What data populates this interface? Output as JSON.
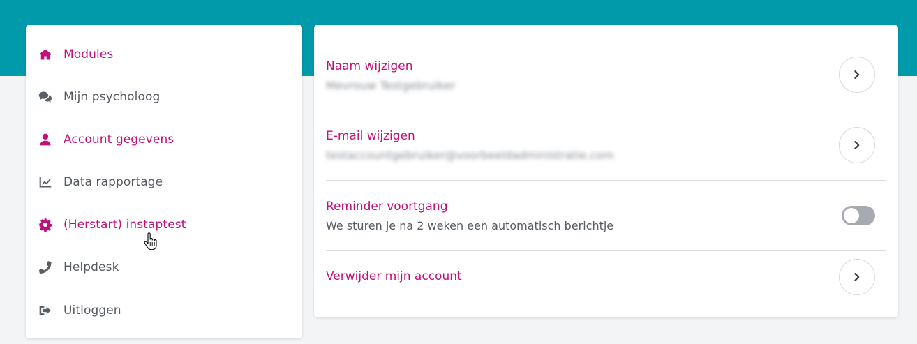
{
  "colors": {
    "header_band": "#009aaa",
    "accent": "#c2107a",
    "text_muted": "#565b62",
    "toggle_off": "#a7abb1"
  },
  "sidebar": {
    "items": [
      {
        "label": "Modules",
        "icon": "home-icon",
        "active": true
      },
      {
        "label": "Mijn psycholoog",
        "icon": "chat-bubbles-icon",
        "active": false
      },
      {
        "label": "Account gegevens",
        "icon": "user-icon",
        "active": true
      },
      {
        "label": "Data rapportage",
        "icon": "line-chart-icon",
        "active": false
      },
      {
        "label": "(Herstart) instaptest",
        "icon": "gear-icon",
        "active": true
      },
      {
        "label": "Helpdesk",
        "icon": "phone-icon",
        "active": false
      },
      {
        "label": "Uitloggen",
        "icon": "sign-out-icon",
        "active": false
      }
    ]
  },
  "account": {
    "name_row": {
      "title": "Naam wijzigen",
      "value": "Mevrouw Testgebruiker"
    },
    "email_row": {
      "title": "E-mail wijzigen",
      "value": "testaccountgebruiker@voorbeeldadministratie.com"
    },
    "reminder_row": {
      "title": "Reminder voortgang",
      "subtitle": "We sturen je na 2 weken een automatisch berichtje",
      "enabled": false
    },
    "delete_row": {
      "title": "Verwijder mijn account"
    }
  }
}
